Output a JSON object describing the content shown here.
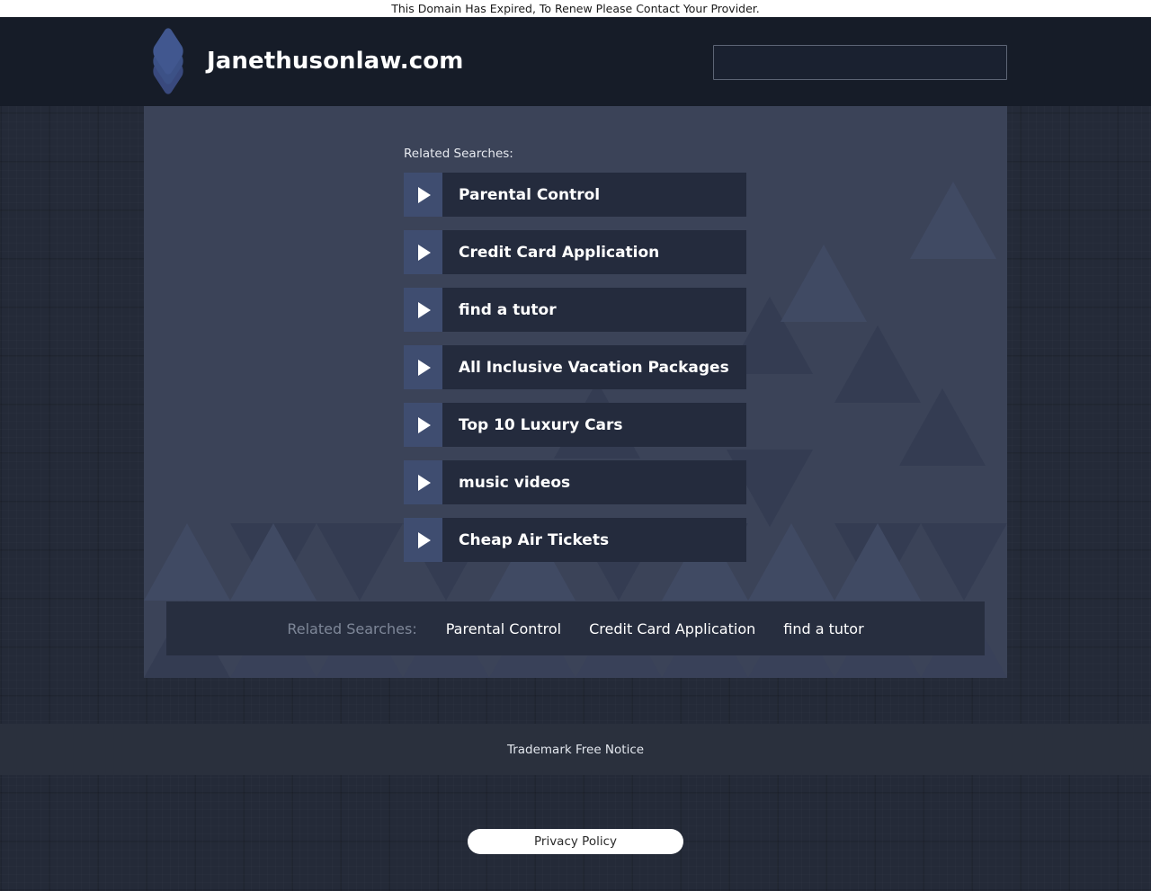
{
  "notice_bar": {
    "text": "This Domain Has Expired, To Renew Please Contact Your Provider."
  },
  "header": {
    "logo_icon": "layers-stack-icon",
    "domain_title": "Janethusonlaw.com",
    "search": {
      "value": "",
      "placeholder": ""
    }
  },
  "main": {
    "related_label": "Related Searches:",
    "results": [
      {
        "label": "Parental Control",
        "icon": "play-triangle-icon"
      },
      {
        "label": "Credit Card Application",
        "icon": "play-triangle-icon"
      },
      {
        "label": "find a tutor",
        "icon": "play-triangle-icon"
      },
      {
        "label": "All Inclusive Vacation Packages",
        "icon": "play-triangle-icon"
      },
      {
        "label": "Top 10 Luxury Cars",
        "icon": "play-triangle-icon"
      },
      {
        "label": "music videos",
        "icon": "play-triangle-icon"
      },
      {
        "label": "Cheap Air Tickets",
        "icon": "play-triangle-icon"
      }
    ]
  },
  "related_strip": {
    "label": "Related Searches:",
    "links": [
      "Parental Control",
      "Credit Card Application",
      "find a tutor"
    ]
  },
  "footer": {
    "trademark_link": "Trademark Free Notice",
    "privacy_button": "Privacy Policy"
  },
  "colors": {
    "page_background": "#242a38",
    "header_background": "#161c28",
    "content_panel": "#3b4358",
    "result_arrow_block": "#3f4d70",
    "result_body": "#242b3d",
    "related_strip": "#272e3f",
    "footer_band": "#2a303d",
    "accent_text": "#ffffff",
    "muted_text": "#7e8798",
    "notice_bar_background": "#ffffff",
    "logo_blue": "#41578f"
  }
}
